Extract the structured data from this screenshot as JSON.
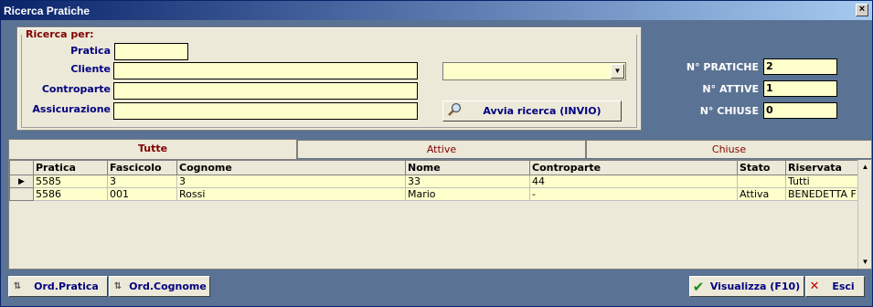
{
  "window": {
    "title": "Ricerca Pratiche"
  },
  "search": {
    "group_label": "Ricerca per:",
    "pratica_label": "Pratica",
    "cliente_label": "Cliente",
    "controparte_label": "Controparte",
    "assicurazione_label": "Assicurazione",
    "pratica_value": "",
    "cliente_value": "",
    "controparte_value": "",
    "assicurazione_value": "",
    "combo_value": "",
    "search_button": "Avvia ricerca (INVIO)"
  },
  "stats": {
    "pratiche_label": "N° PRATICHE",
    "pratiche_value": "2",
    "attive_label": "N° ATTIVE",
    "attive_value": "1",
    "chiuse_label": "N° CHIUSE",
    "chiuse_value": "0"
  },
  "tabs": [
    {
      "label": "Tutte",
      "active": true
    },
    {
      "label": "Attive",
      "active": false
    },
    {
      "label": "Chiuse",
      "active": false
    }
  ],
  "table": {
    "columns": [
      "Pratica",
      "Fascicolo",
      "Cognome",
      "Nome",
      "Controparte",
      "Stato",
      "Riservata"
    ],
    "rows": [
      [
        "5585",
        "3",
        "3",
        "33",
        "44",
        "",
        "Tutti"
      ],
      [
        "5586",
        "001",
        "Rossi",
        "Mario",
        "-",
        "Attiva",
        "BENEDETTA F"
      ]
    ],
    "selected_marker": "▶"
  },
  "buttons": {
    "ord_pratica": "Ord.Pratica",
    "ord_cognome": "Ord.Cognome",
    "visualizza": "Visualizza  (F10)",
    "esci": "Esci"
  },
  "colors": {
    "window_bg": "#5a7394",
    "field_bg": "#ffffcc",
    "label_blue": "#000080",
    "accent_red": "#800000"
  }
}
